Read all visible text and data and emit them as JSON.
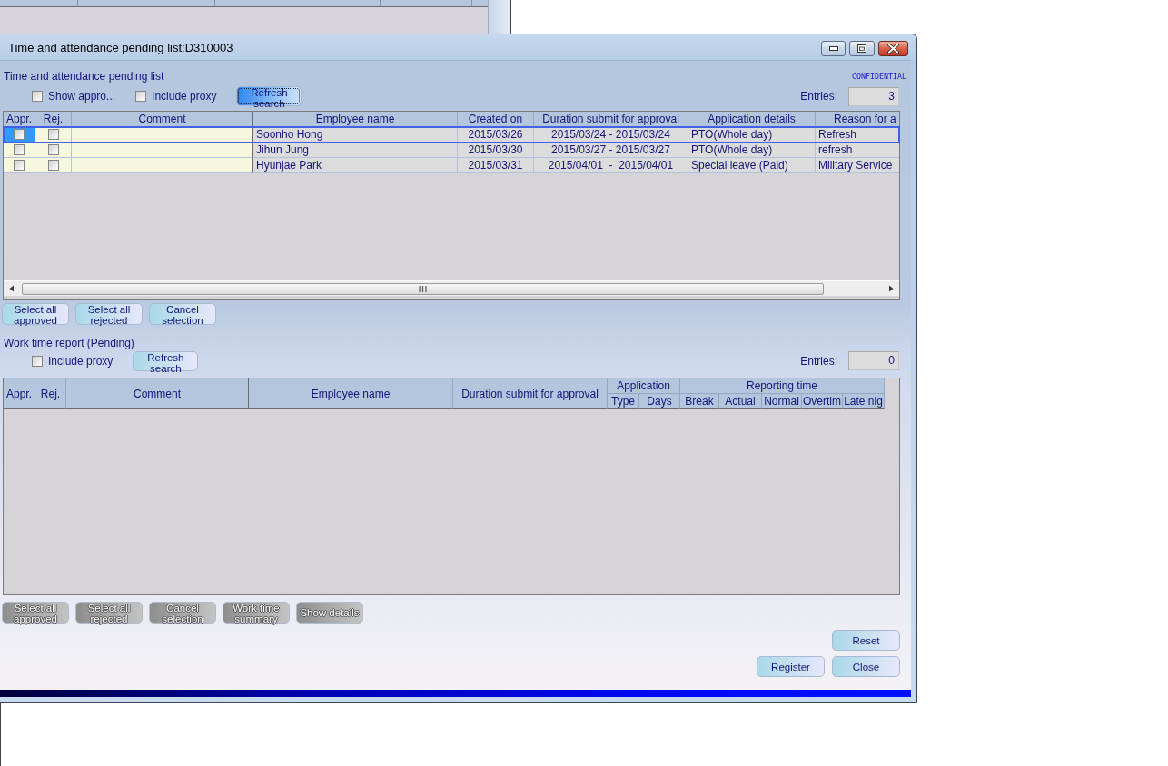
{
  "window": {
    "title": "Time and attendance pending list:D310003"
  },
  "pending_list": {
    "heading": "Time and attendance pending list",
    "notice": "CONFIDENTIAL",
    "filters": [
      {
        "label": "Show appro...",
        "checked": false
      },
      {
        "label": "Include proxy",
        "checked": false
      }
    ],
    "refresh_button": {
      "label": "Refresh search",
      "focused": true
    },
    "entries": {
      "label": "Entries:",
      "value": "3"
    },
    "table": {
      "columns": [
        "Appr.",
        "Rej.",
        "Comment",
        "Employee name",
        "Created on",
        "Duration submit for approval",
        "Application details",
        "Reason for a"
      ],
      "rows": [
        {
          "selected": true,
          "cells": [
            {
              "kind": "checkbox",
              "checked": false
            },
            {
              "kind": "checkbox",
              "checked": false
            },
            {
              "kind": "field"
            },
            {
              "kind": "text",
              "text": "Soonho Hong"
            },
            {
              "kind": "text",
              "text": "2015/03/26"
            },
            {
              "kind": "text",
              "text": "2015/03/24 - 2015/03/24"
            },
            {
              "kind": "text",
              "text": "PTO(Whole day)"
            },
            {
              "kind": "text",
              "text": "Refresh"
            }
          ]
        },
        {
          "selected": false,
          "cells": [
            {
              "kind": "checkbox",
              "checked": false
            },
            {
              "kind": "checkbox",
              "checked": false
            },
            {
              "kind": "field"
            },
            {
              "kind": "text",
              "text": "Jihun Jung"
            },
            {
              "kind": "text",
              "text": "2015/03/30"
            },
            {
              "kind": "text",
              "text": "2015/03/27 - 2015/03/27"
            },
            {
              "kind": "text",
              "text": "PTO(Whole day)"
            },
            {
              "kind": "text",
              "text": "refresh"
            }
          ]
        },
        {
          "selected": false,
          "cells": [
            {
              "kind": "checkbox",
              "checked": false
            },
            {
              "kind": "checkbox",
              "checked": false
            },
            {
              "kind": "field"
            },
            {
              "kind": "text",
              "text": "Hyunjae Park"
            },
            {
              "kind": "text",
              "text": "2015/03/31"
            },
            {
              "kind": "text",
              "text": "2015/04/01  -  2015/04/01"
            },
            {
              "kind": "text",
              "text": "Special leave (Paid)"
            },
            {
              "kind": "text",
              "text": "Military Service"
            }
          ]
        }
      ]
    },
    "buttons": [
      {
        "label": "Select all approved",
        "disabled": false
      },
      {
        "label": "Select all rejected",
        "disabled": false
      },
      {
        "label": "Cancel selection",
        "disabled": false
      }
    ]
  },
  "work_time_report": {
    "heading": "Work time report (Pending)",
    "filters": [
      {
        "label": "Include proxy",
        "checked": false
      }
    ],
    "refresh_button": {
      "label": "Refresh search",
      "focused": false
    },
    "entries": {
      "label": "Entries:",
      "value": "0"
    },
    "table": {
      "columns": [
        {
          "label": "Appr."
        },
        {
          "label": "Rej."
        },
        {
          "label": "Comment"
        },
        {
          "label": "Employee name"
        },
        {
          "label": "Duration submit for approval"
        },
        {
          "label": "Application",
          "children": [
            {
              "label": "Type"
            },
            {
              "label": "Days"
            }
          ]
        },
        {
          "label": "Reporting time",
          "children": [
            {
              "label": "Break"
            },
            {
              "label": "Actual"
            },
            {
              "label": "Normal"
            },
            {
              "label": "Overtim"
            },
            {
              "label": "Late nig"
            }
          ]
        }
      ]
    },
    "buttons": [
      {
        "label": "Select all approved",
        "disabled": true
      },
      {
        "label": "Select all rejected",
        "disabled": true
      },
      {
        "label": "Cancel selection",
        "disabled": true
      },
      {
        "label": "Work time summary",
        "disabled": true
      },
      {
        "label": "Show details",
        "disabled": true
      }
    ]
  },
  "footer": {
    "rows": [
      {
        "buttons": [
          {
            "label": "Reset"
          }
        ]
      },
      {
        "buttons": [
          {
            "label": "Register"
          },
          {
            "label": "Close"
          }
        ]
      }
    ]
  }
}
